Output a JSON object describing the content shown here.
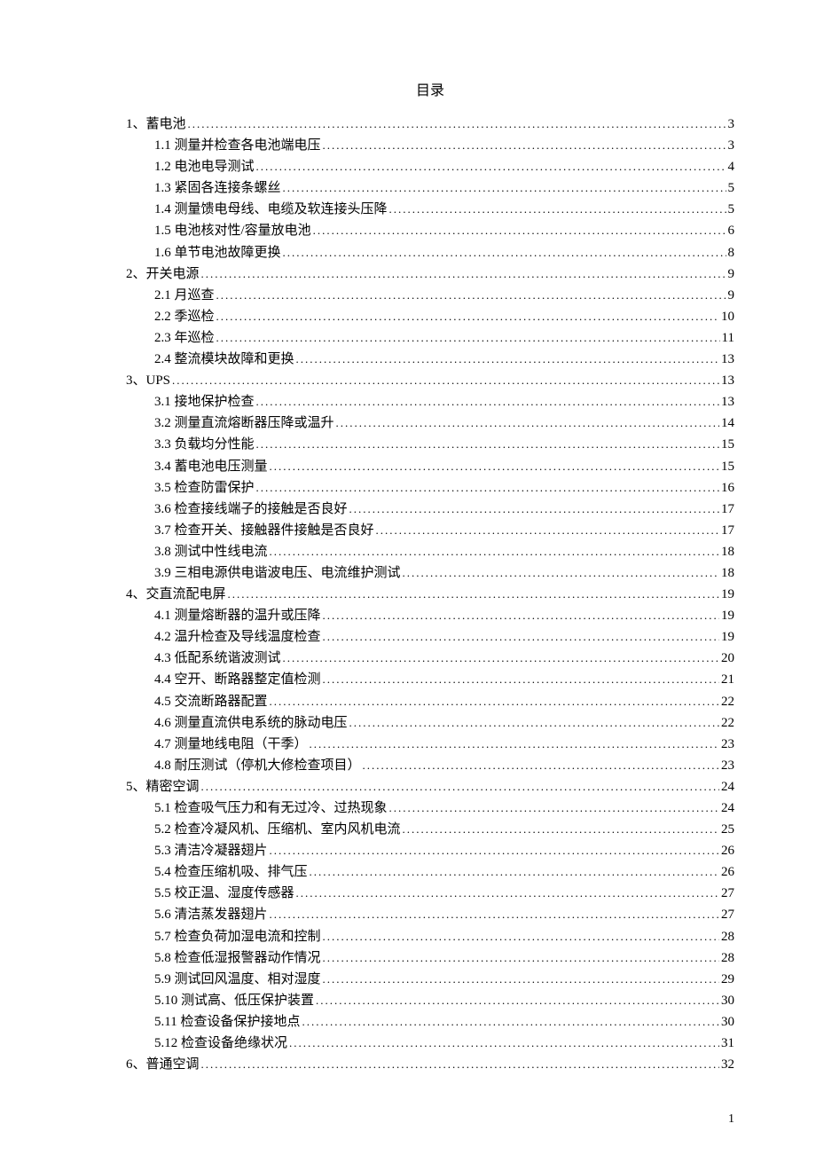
{
  "title": "目录",
  "page_number": "1",
  "toc": [
    {
      "indent": 0,
      "label": "1、蓄电池",
      "page": "3"
    },
    {
      "indent": 1,
      "label": "1.1 测量并检查各电池端电压",
      "page": "3"
    },
    {
      "indent": 1,
      "label": "1.2 电池电导测试",
      "page": "4"
    },
    {
      "indent": 1,
      "label": "1.3 紧固各连接条螺丝",
      "page": "5"
    },
    {
      "indent": 1,
      "label": "1.4 测量馈电母线、电缆及软连接头压降",
      "page": "5"
    },
    {
      "indent": 1,
      "label": "1.5 电池核对性/容量放电池",
      "page": "6"
    },
    {
      "indent": 1,
      "label": "1.6 单节电池故障更换",
      "page": "8"
    },
    {
      "indent": 0,
      "label": "2、开关电源",
      "page": "9"
    },
    {
      "indent": 1,
      "label": "2.1 月巡查",
      "page": "9"
    },
    {
      "indent": 1,
      "label": "2.2 季巡检",
      "page": "10"
    },
    {
      "indent": 1,
      "label": "2.3 年巡检",
      "page": "11"
    },
    {
      "indent": 1,
      "label": "2.4 整流模块故障和更换",
      "page": "13"
    },
    {
      "indent": 0,
      "label": "3、UPS",
      "page": "13"
    },
    {
      "indent": 1,
      "label": "3.1 接地保护检查",
      "page": "13"
    },
    {
      "indent": 1,
      "label": "3.2 测量直流熔断器压降或温升",
      "page": "14"
    },
    {
      "indent": 1,
      "label": "3.3 负载均分性能",
      "page": "15"
    },
    {
      "indent": 1,
      "label": "3.4 蓄电池电压测量",
      "page": "15"
    },
    {
      "indent": 1,
      "label": "3.5 检查防雷保护",
      "page": "16"
    },
    {
      "indent": 1,
      "label": "3.6 检查接线端子的接触是否良好",
      "page": "17"
    },
    {
      "indent": 1,
      "label": "3.7 检查开关、接触器件接触是否良好",
      "page": "17"
    },
    {
      "indent": 1,
      "label": "3.8 测试中性线电流",
      "page": "18"
    },
    {
      "indent": 1,
      "label": "3.9 三相电源供电谐波电压、电流维护测试",
      "page": "18"
    },
    {
      "indent": 0,
      "label": "4、交直流配电屏",
      "page": "19"
    },
    {
      "indent": 1,
      "label": "4.1 测量熔断器的温升或压降",
      "page": "19"
    },
    {
      "indent": 1,
      "label": "4.2 温升检查及导线温度检查",
      "page": "19"
    },
    {
      "indent": 1,
      "label": "4.3 低配系统谐波测试",
      "page": "20"
    },
    {
      "indent": 1,
      "label": "4.4 空开、断路器整定值检测",
      "page": "21"
    },
    {
      "indent": 1,
      "label": "4.5 交流断路器配置",
      "page": "22"
    },
    {
      "indent": 1,
      "label": "4.6 测量直流供电系统的脉动电压",
      "page": "22"
    },
    {
      "indent": 1,
      "label": "4.7 测量地线电阻（干季）",
      "page": "23"
    },
    {
      "indent": 1,
      "label": "4.8 耐压测试（停机大修检查项目）",
      "page": "23"
    },
    {
      "indent": 0,
      "label": "5、精密空调",
      "page": "24"
    },
    {
      "indent": 1,
      "label": "5.1 检查吸气压力和有无过冷、过热现象",
      "page": "24"
    },
    {
      "indent": 1,
      "label": "5.2 检查冷凝风机、压缩机、室内风机电流",
      "page": "25"
    },
    {
      "indent": 1,
      "label": "5.3 清洁冷凝器翅片",
      "page": "26"
    },
    {
      "indent": 1,
      "label": "5.4 检查压缩机吸、排气压",
      "page": "26"
    },
    {
      "indent": 1,
      "label": "5.5 校正温、湿度传感器",
      "page": "27"
    },
    {
      "indent": 1,
      "label": "5.6 清洁蒸发器翅片",
      "page": "27"
    },
    {
      "indent": 1,
      "label": "5.7 检查负荷加湿电流和控制",
      "page": "28"
    },
    {
      "indent": 1,
      "label": "5.8 检查低湿报警器动作情况",
      "page": "28"
    },
    {
      "indent": 1,
      "label": "5.9 测试回风温度、相对湿度",
      "page": "29"
    },
    {
      "indent": 1,
      "label": "5.10 测试高、低压保护装置",
      "page": "30"
    },
    {
      "indent": 1,
      "label": "5.11 检查设备保护接地点",
      "page": "30"
    },
    {
      "indent": 1,
      "label": "5.12 检查设备绝缘状况",
      "page": "31"
    },
    {
      "indent": 0,
      "label": "6、普通空调",
      "page": "32"
    }
  ]
}
